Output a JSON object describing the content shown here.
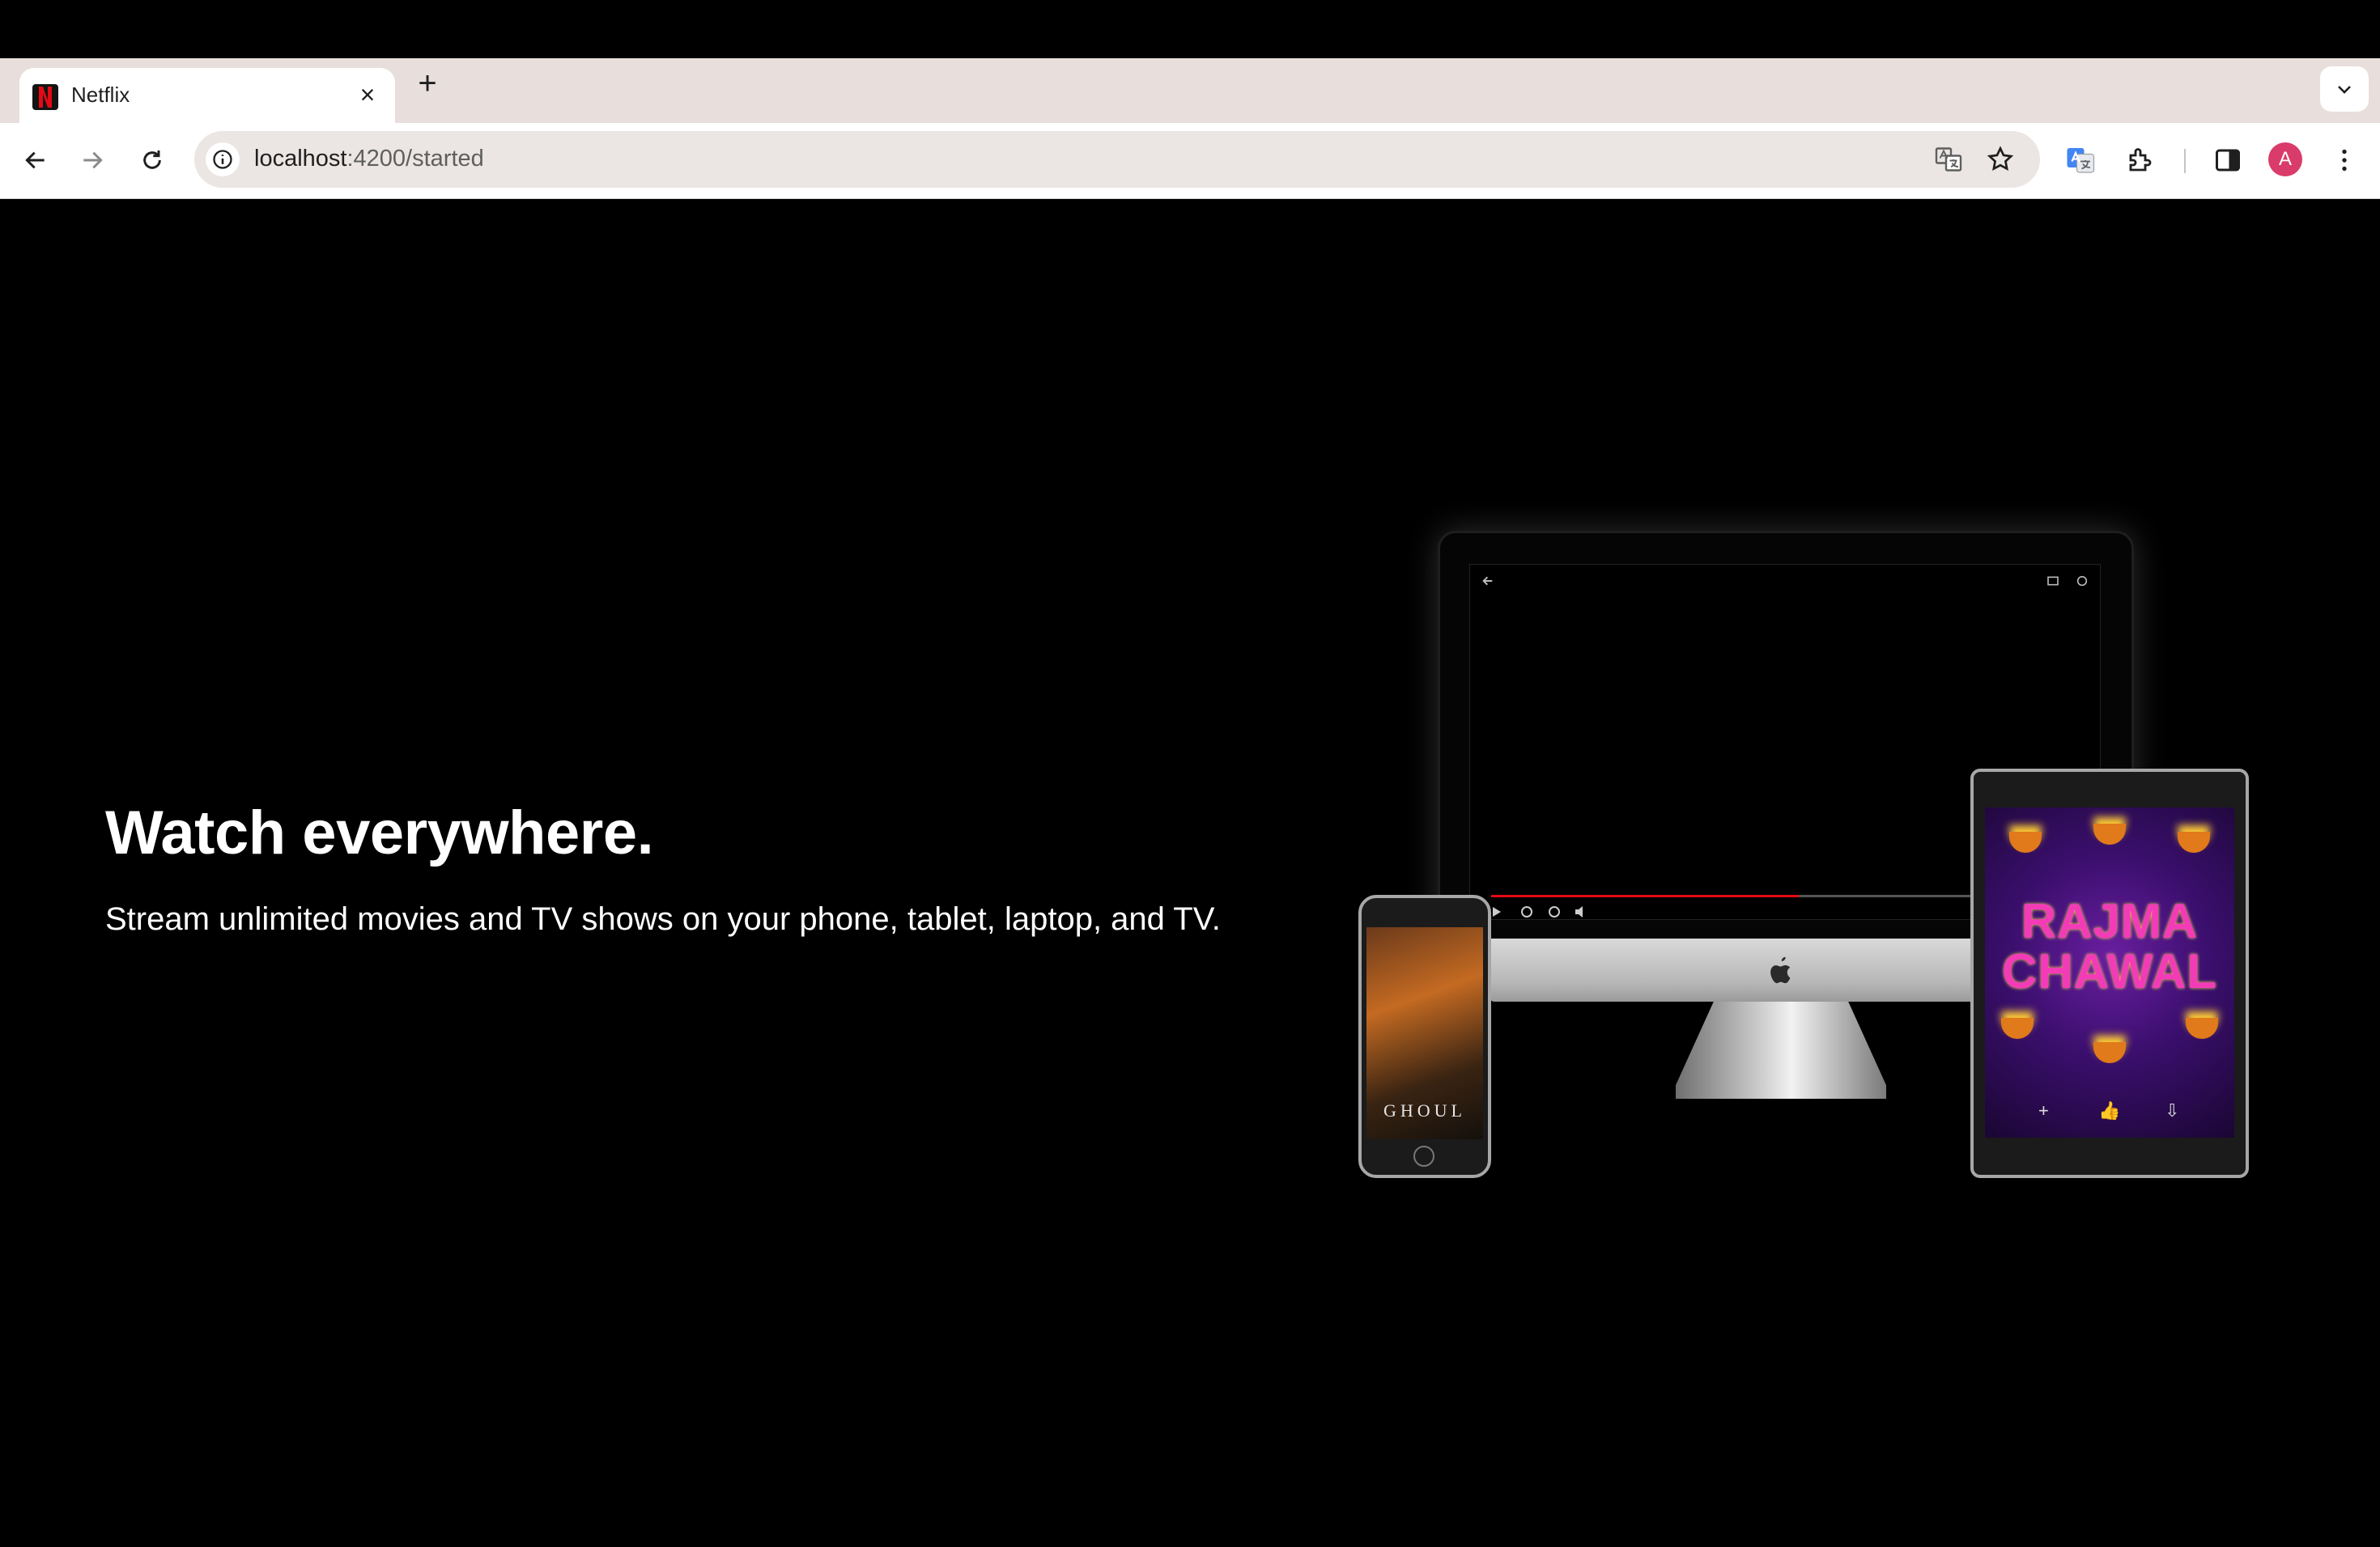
{
  "browser": {
    "tab": {
      "title": "Netflix",
      "close": "×"
    },
    "new_tab": "+",
    "url": {
      "host": "localhost",
      "rest": ":4200/started"
    },
    "profile_initial": "A"
  },
  "hero": {
    "headline": "Watch everywhere.",
    "subline": "Stream unlimited movies and TV shows on your phone, tablet, laptop, and TV."
  },
  "devices": {
    "phone_title": "GHOUL",
    "tablet_title": "RAJMA CHAWAL",
    "tablet_controls": [
      "+",
      "👍",
      "⇩"
    ]
  },
  "colors": {
    "brand": "#e50914",
    "avatar": "#d93c6a",
    "tab_strip": "#e8dedb"
  },
  "icons": [
    "back-icon",
    "forward-icon",
    "reload-icon",
    "info-icon",
    "translate-icon",
    "star-icon",
    "google-translate-icon",
    "extensions-icon",
    "side-panel-icon",
    "more-icon",
    "chevron-down-icon",
    "close-icon"
  ]
}
